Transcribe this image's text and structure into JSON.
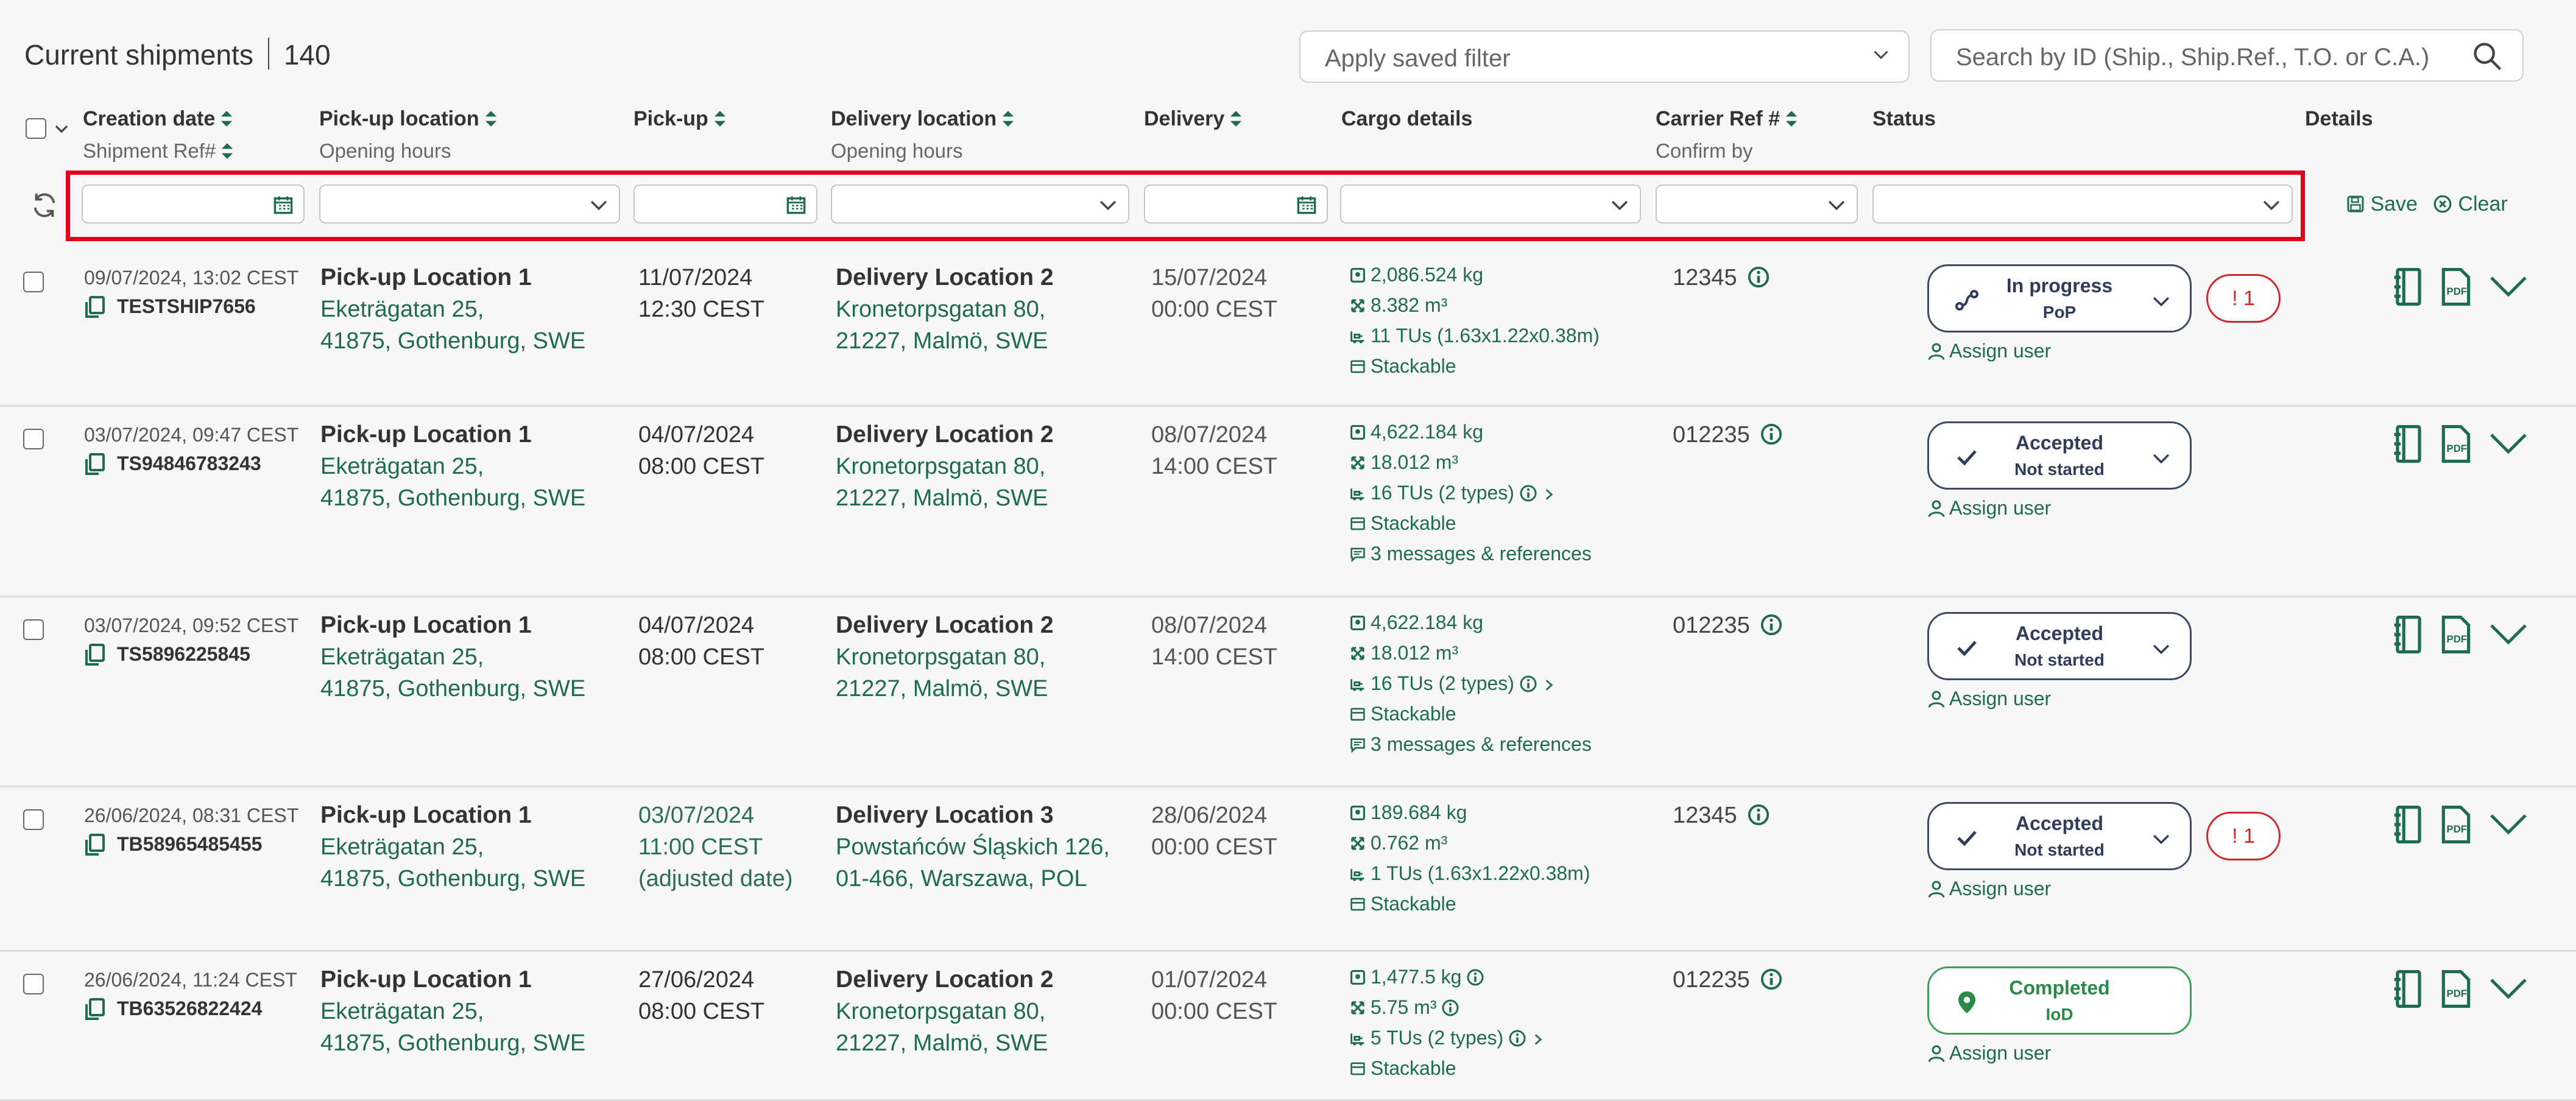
{
  "header": {
    "title": "Current shipments",
    "count": "140",
    "saved_filter_placeholder": "Apply saved filter",
    "search_placeholder": "Search by ID (Ship., Ship.Ref., T.O. or C.A.)"
  },
  "columns": {
    "creation_date": "Creation date",
    "shipment_ref": "Shipment Ref#",
    "pickup_location": "Pick-up location",
    "opening_hours_1": "Opening hours",
    "pickup": "Pick-up",
    "delivery_location": "Delivery location",
    "opening_hours_2": "Opening hours",
    "delivery": "Delivery",
    "cargo": "Cargo details",
    "carrier_ref": "Carrier Ref #",
    "confirm_by": "Confirm by",
    "status": "Status",
    "details": "Details"
  },
  "filter_actions": {
    "save": "Save",
    "clear": "Clear"
  },
  "rows": [
    {
      "created": "09/07/2024, 13:02 CEST",
      "ship_ref": "TESTSHIP7656",
      "pickup_name": "Pick-up Location 1",
      "pickup_addr1": "Eketrägatan 25,",
      "pickup_addr2": "41875, Gothenburg, SWE",
      "pickup_date": "11/07/2024",
      "pickup_time": "12:30 CEST",
      "pickup_note": "",
      "delivery_name": "Delivery Location 2",
      "delivery_addr1": "Kronetorpsgatan 80,",
      "delivery_addr2": "21227, Malmö, SWE",
      "delivery_date": "15/07/2024",
      "delivery_time": "00:00 CEST",
      "weight": "2,086.524 kg",
      "volume": "8.382 m³",
      "tus": "11 TUs (1.63x1.22x0.38m)",
      "stackable": "Stackable",
      "messages": "",
      "carrier_ref": "12345",
      "status_l1": "In progress",
      "status_l2": "PoP",
      "alert": "! 1",
      "assign": "Assign user"
    },
    {
      "created": "03/07/2024, 09:47 CEST",
      "ship_ref": "TS94846783243",
      "pickup_name": "Pick-up Location 1",
      "pickup_addr1": "Eketrägatan 25,",
      "pickup_addr2": "41875, Gothenburg, SWE",
      "pickup_date": "04/07/2024",
      "pickup_time": "08:00 CEST",
      "pickup_note": "",
      "delivery_name": "Delivery Location 2",
      "delivery_addr1": "Kronetorpsgatan 80,",
      "delivery_addr2": "21227, Malmö, SWE",
      "delivery_date": "08/07/2024",
      "delivery_time": "14:00 CEST",
      "weight": "4,622.184 kg",
      "volume": "18.012 m³",
      "tus": "16 TUs (2 types)",
      "stackable": "Stackable",
      "messages": "3 messages & references",
      "carrier_ref": "012235",
      "status_l1": "Accepted",
      "status_l2": "Not started",
      "alert": "",
      "assign": "Assign user"
    },
    {
      "created": "03/07/2024, 09:52 CEST",
      "ship_ref": "TS5896225845",
      "pickup_name": "Pick-up Location 1",
      "pickup_addr1": "Eketrägatan 25,",
      "pickup_addr2": "41875, Gothenburg, SWE",
      "pickup_date": "04/07/2024",
      "pickup_time": "08:00 CEST",
      "pickup_note": "",
      "delivery_name": "Delivery Location 2",
      "delivery_addr1": "Kronetorpsgatan 80,",
      "delivery_addr2": "21227, Malmö, SWE",
      "delivery_date": "08/07/2024",
      "delivery_time": "14:00 CEST",
      "weight": "4,622.184 kg",
      "volume": "18.012 m³",
      "tus": "16 TUs (2 types)",
      "stackable": "Stackable",
      "messages": "3 messages & references",
      "carrier_ref": "012235",
      "status_l1": "Accepted",
      "status_l2": "Not started",
      "alert": "",
      "assign": "Assign user"
    },
    {
      "created": "26/06/2024, 08:31 CEST",
      "ship_ref": "TB58965485455",
      "pickup_name": "Pick-up Location 1",
      "pickup_addr1": "Eketrägatan 25,",
      "pickup_addr2": "41875, Gothenburg, SWE",
      "pickup_date": "03/07/2024",
      "pickup_time": "11:00 CEST",
      "pickup_note": "(adjusted date)",
      "delivery_name": "Delivery Location 3",
      "delivery_addr1": "Powstańców Śląskich 126,",
      "delivery_addr2": "01-466, Warszawa, POL",
      "delivery_date": "28/06/2024",
      "delivery_time": "00:00 CEST",
      "weight": "189.684 kg",
      "volume": "0.762 m³",
      "tus": "1 TUs (1.63x1.22x0.38m)",
      "stackable": "Stackable",
      "messages": "",
      "carrier_ref": "12345",
      "status_l1": "Accepted",
      "status_l2": "Not started",
      "alert": "! 1",
      "assign": "Assign user"
    },
    {
      "created": "26/06/2024, 11:24 CEST",
      "ship_ref": "TB63526822424",
      "pickup_name": "Pick-up Location 1",
      "pickup_addr1": "Eketrägatan 25,",
      "pickup_addr2": "41875, Gothenburg, SWE",
      "pickup_date": "27/06/2024",
      "pickup_time": "08:00 CEST",
      "pickup_note": "",
      "delivery_name": "Delivery Location 2",
      "delivery_addr1": "Kronetorpsgatan 80,",
      "delivery_addr2": "21227, Malmö, SWE",
      "delivery_date": "01/07/2024",
      "delivery_time": "00:00 CEST",
      "weight": "1,477.5 kg",
      "volume": "5.75 m³",
      "tus": "5 TUs (2 types)",
      "stackable": "Stackable",
      "messages": "",
      "carrier_ref": "012235",
      "status_l1": "Completed",
      "status_l2": "IoD",
      "alert": "",
      "assign": "Assign user"
    }
  ],
  "colors": {
    "accent": "#1f6b50",
    "alert": "#d2262c",
    "highlight": "#e3001b",
    "status_border": "#3d4a63",
    "completed": "#3aa05a"
  },
  "icons": [
    "search-icon",
    "chevron-down-icon",
    "sort-icon",
    "calendar-icon",
    "refresh-icon",
    "save-icon",
    "clear-icon",
    "copy-icon",
    "weight-icon",
    "volume-icon",
    "pallet-icon",
    "stackable-icon",
    "message-icon",
    "info-icon",
    "route-icon",
    "check-icon",
    "pin-icon",
    "user-icon",
    "document-icon",
    "pdf-icon"
  ]
}
